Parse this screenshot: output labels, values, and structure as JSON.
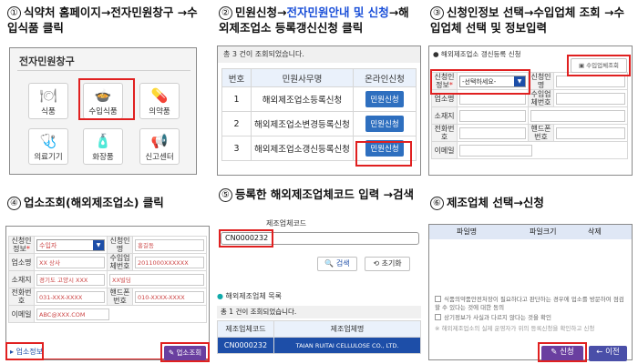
{
  "captions": {
    "c1": {
      "num": "①",
      "text": "식약처 홈페이지→전자민원창구 →수입식품 클릭"
    },
    "c2": {
      "num": "②",
      "pre": "민원신청→",
      "hl": "전자민원안내 및 신청",
      "post": "→해외제조업소 등록갱신신청 클릭"
    },
    "c3": {
      "num": "③",
      "text": "신청인정보 선택→수입업체 조회 →수입업체 선택 및 정보입력"
    },
    "c4": {
      "num": "④",
      "text": "업소조회(해외제조업소) 클릭"
    },
    "c5": {
      "num": "⑤",
      "text": "등록한 해외제조업체코드 입력 →검색"
    },
    "c6": {
      "num": "⑥",
      "text": "제조업체 선택→신청"
    }
  },
  "panel1": {
    "title": "전자민원창구",
    "icons": [
      {
        "name": "food-icon",
        "glyph": "🍽",
        "label": "식품"
      },
      {
        "name": "imported-food-icon",
        "glyph": "🍲",
        "label": "수입식품"
      },
      {
        "name": "medicine-icon",
        "glyph": "💊",
        "label": "의약품"
      },
      {
        "name": "medical-device-icon",
        "glyph": "🩺",
        "label": "의료기기"
      },
      {
        "name": "cosmetics-icon",
        "glyph": "🧴",
        "label": "화장품"
      },
      {
        "name": "report-center-icon",
        "glyph": "📢",
        "label": "신고센터"
      }
    ]
  },
  "panel2": {
    "info": "총 3 건이 조회되었습니다.",
    "headers": [
      "번호",
      "민원사무명",
      "온라인신청"
    ],
    "rows": [
      {
        "no": "1",
        "name": "해외제조업소등록신청",
        "btn": "민원신청"
      },
      {
        "no": "2",
        "name": "해외제조업소변경등록신청",
        "btn": "민원신청"
      },
      {
        "no": "3",
        "name": "해외제조업소갱신등록신청",
        "btn": "민원신청"
      }
    ]
  },
  "panel3": {
    "bar": "● 해외제조업소 갱신등록 신청",
    "lookup_btn": "수입업체조회",
    "applicant_label": "신청인정보",
    "select_value": "-선택하세요-",
    "applicant_name_label": "신청인명",
    "company_label": "업소명",
    "company_no_label": "수입업체번호",
    "address_label": "소재지",
    "phone_label": "전화번호",
    "mobile_label": "핸드폰번호",
    "email_label": "이메일"
  },
  "panel4": {
    "applicant_label": "신청인정보",
    "select_value": "수입자",
    "applicant_name_label": "신청인명",
    "applicant_name_value": "홍길동",
    "company_label": "업소명",
    "company_value": "XX 상사",
    "company_no_label": "수입업체번호",
    "company_no_value": "2011000XXXXXX",
    "address_label": "소재지",
    "address_value": "경기도 고양시 XXX",
    "address2_value": "XX빌딩",
    "phone_label": "전화번호",
    "phone_value": "031-XXX-XXXX",
    "mobile_label": "핸드폰번호",
    "mobile_value": "010-XXXX-XXXX",
    "email_label": "이메일",
    "email_value": "ABC@XXX.COM",
    "section_label": "업소정보",
    "lookup_btn": "업소조회"
  },
  "panel5": {
    "code_label": "제조업체코드",
    "code_value": "CN0000232",
    "search_btn": "검색",
    "reset_btn": "초기화",
    "list_title": "해외제조업체 목록",
    "info": "총 1 건이 조회되었습니다.",
    "headers": [
      "제조업체코드",
      "제조업체명"
    ],
    "row": {
      "code": "CN0000232",
      "name": "TAIAN RUITAI CELLULOSE CO., LTD."
    }
  },
  "panel6": {
    "tabs": [
      "파일명",
      "파일크기",
      "삭제"
    ],
    "check1": "식품의약품안전처장이 필요하다고 판단하는 경우에 업소를 방문하여 점검할 수 있다는 것에 대한 동의",
    "check2": "상기정보가 사실과 다르지 않다는 것을 확인",
    "note": "※ 해외제조업소의 실제 운영자가 위의 등록신청을 확인하고 신청",
    "apply_btn": "신청",
    "prev_btn": "이전"
  },
  "colors": {
    "highlight": "#e02020",
    "caption_blue": "#1a4fd8",
    "button_blue": "#2e6fbf"
  }
}
